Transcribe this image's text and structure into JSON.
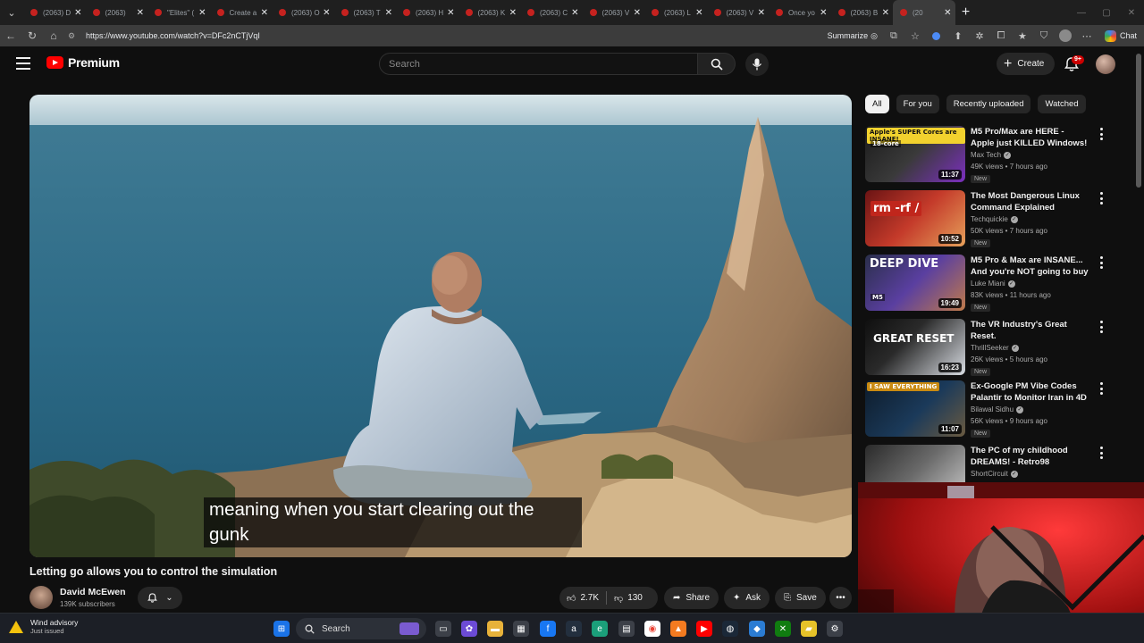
{
  "browser": {
    "tabs": [
      {
        "title": "(2063) D"
      },
      {
        "title": "(2063) "
      },
      {
        "title": "\"Elites\" ("
      },
      {
        "title": "Create a"
      },
      {
        "title": "(2063) O"
      },
      {
        "title": "(2063) T"
      },
      {
        "title": "(2063) H"
      },
      {
        "title": "(2063) K"
      },
      {
        "title": "(2063) C"
      },
      {
        "title": "(2063) V"
      },
      {
        "title": "(2063) L"
      },
      {
        "title": "(2063) V"
      },
      {
        "title": "Once yo"
      },
      {
        "title": "(2063) B"
      },
      {
        "title": "(20"
      }
    ],
    "url_prefix": "https://",
    "url_host": "www.youtube.com",
    "url_path": "/watch?v=DFc2nCTjVqI",
    "summarize_label": "Summarize",
    "chat_label": "Chat"
  },
  "header": {
    "logo_text": "Premium",
    "search_placeholder": "Search",
    "create_label": "Create",
    "notification_badge": "9+"
  },
  "video": {
    "caption_line1": "meaning when you start clearing out the",
    "caption_line2": "gunk",
    "title": "Letting go allows you to control the simulation",
    "channel": "David McEwen",
    "subscribers": "139K subscribers",
    "likes": "2.7K",
    "dislikes": "130",
    "share_label": "Share",
    "ask_label": "Ask",
    "save_label": "Save"
  },
  "sidebar": {
    "chips": [
      {
        "label": "All",
        "active": true
      },
      {
        "label": "For you"
      },
      {
        "label": "Recently uploaded"
      },
      {
        "label": "Watched"
      }
    ],
    "recommendations": [
      {
        "title": "M5 Pro/Max are HERE - Apple just KILLED Windows!",
        "channel": "Max Tech",
        "meta": "49K views • 7 hours ago",
        "badge": "New",
        "duration": "11:37",
        "thumb_text": "Apple's SUPER Cores are INSANE!",
        "thumb_sub": "18-core"
      },
      {
        "title": "The Most Dangerous Linux Command Explained",
        "channel": "Techquickie",
        "meta": "50K views • 7 hours ago",
        "badge": "New",
        "duration": "10:52",
        "thumb_text": "rm -rf /"
      },
      {
        "title": "M5 Pro & Max are INSANE... And you're NOT going to buy ...",
        "channel": "Luke Miani",
        "meta": "83K views • 11 hours ago",
        "badge": "New",
        "duration": "19:49",
        "thumb_text": "DEEP DIVE",
        "thumb_sub": "M5"
      },
      {
        "title": "The VR Industry's Great Reset.",
        "channel": "ThrillSeeker",
        "meta": "26K views • 5 hours ago",
        "badge": "New",
        "duration": "16:23",
        "thumb_text": "GREAT RESET"
      },
      {
        "title": "Ex-Google PM Vibe Codes Palantir to Monitor Iran in 4D",
        "channel": "Bilawal Sidhu",
        "meta": "56K views • 9 hours ago",
        "badge": "New",
        "duration": "11:07",
        "thumb_text": "I SAW EVERYTHING"
      },
      {
        "title": "The PC of my childhood DREAMS! - Retro98",
        "channel": "ShortCircuit",
        "meta": "",
        "badge": "",
        "duration": "",
        "thumb_text": ""
      }
    ]
  },
  "taskbar": {
    "weather_title": "Wind advisory",
    "weather_sub": "Just issued",
    "search_label": "Search"
  },
  "colors": {
    "yt_red": "#ff0000",
    "background": "#0f0f0f",
    "pill": "#272727"
  }
}
